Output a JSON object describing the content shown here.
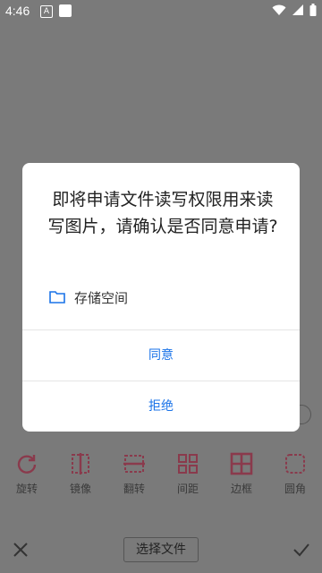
{
  "status_bar": {
    "time": "4:46",
    "notif_letter": "A"
  },
  "tools": [
    {
      "label": "旋转",
      "icon": "rotate-icon"
    },
    {
      "label": "镜像",
      "icon": "mirror-icon"
    },
    {
      "label": "翻转",
      "icon": "flip-icon"
    },
    {
      "label": "间距",
      "icon": "spacing-icon"
    },
    {
      "label": "边框",
      "icon": "border-icon"
    },
    {
      "label": "圆角",
      "icon": "rounded-corner-icon"
    }
  ],
  "bottom_bar": {
    "choose_file_label": "选择文件"
  },
  "dialog": {
    "message": "即将申请文件读写权限用来读写图片，请确认是否同意申请?",
    "permission_label": "存储空间",
    "agree_label": "同意",
    "reject_label": "拒绝"
  },
  "colors": {
    "accent": "#1a73e8",
    "tool_icon": "#d04a6a",
    "scrim": "#7a7a7a"
  }
}
